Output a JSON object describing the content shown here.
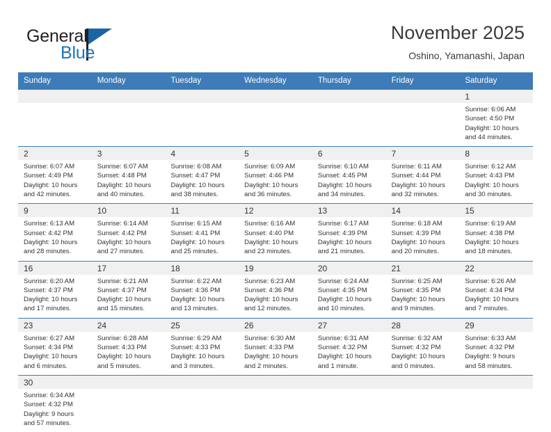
{
  "brand": {
    "name_top": "General",
    "name_bottom": "Blue",
    "accent_color": "#1b75bb",
    "flag_color": "#1b64a5"
  },
  "header": {
    "title": "November 2025",
    "subtitle": "Oshino, Yamanashi, Japan"
  },
  "theme": {
    "header_blue": "#3d7cb8",
    "day_band_gray": "#f0f0f0",
    "text_color": "#333333"
  },
  "weekdays": [
    "Sunday",
    "Monday",
    "Tuesday",
    "Wednesday",
    "Thursday",
    "Friday",
    "Saturday"
  ],
  "weeks": [
    [
      {
        "day": "",
        "lines": []
      },
      {
        "day": "",
        "lines": []
      },
      {
        "day": "",
        "lines": []
      },
      {
        "day": "",
        "lines": []
      },
      {
        "day": "",
        "lines": []
      },
      {
        "day": "",
        "lines": []
      },
      {
        "day": "1",
        "lines": [
          "Sunrise: 6:06 AM",
          "Sunset: 4:50 PM",
          "Daylight: 10 hours",
          "and 44 minutes."
        ]
      }
    ],
    [
      {
        "day": "2",
        "lines": [
          "Sunrise: 6:07 AM",
          "Sunset: 4:49 PM",
          "Daylight: 10 hours",
          "and 42 minutes."
        ]
      },
      {
        "day": "3",
        "lines": [
          "Sunrise: 6:07 AM",
          "Sunset: 4:48 PM",
          "Daylight: 10 hours",
          "and 40 minutes."
        ]
      },
      {
        "day": "4",
        "lines": [
          "Sunrise: 6:08 AM",
          "Sunset: 4:47 PM",
          "Daylight: 10 hours",
          "and 38 minutes."
        ]
      },
      {
        "day": "5",
        "lines": [
          "Sunrise: 6:09 AM",
          "Sunset: 4:46 PM",
          "Daylight: 10 hours",
          "and 36 minutes."
        ]
      },
      {
        "day": "6",
        "lines": [
          "Sunrise: 6:10 AM",
          "Sunset: 4:45 PM",
          "Daylight: 10 hours",
          "and 34 minutes."
        ]
      },
      {
        "day": "7",
        "lines": [
          "Sunrise: 6:11 AM",
          "Sunset: 4:44 PM",
          "Daylight: 10 hours",
          "and 32 minutes."
        ]
      },
      {
        "day": "8",
        "lines": [
          "Sunrise: 6:12 AM",
          "Sunset: 4:43 PM",
          "Daylight: 10 hours",
          "and 30 minutes."
        ]
      }
    ],
    [
      {
        "day": "9",
        "lines": [
          "Sunrise: 6:13 AM",
          "Sunset: 4:42 PM",
          "Daylight: 10 hours",
          "and 28 minutes."
        ]
      },
      {
        "day": "10",
        "lines": [
          "Sunrise: 6:14 AM",
          "Sunset: 4:42 PM",
          "Daylight: 10 hours",
          "and 27 minutes."
        ]
      },
      {
        "day": "11",
        "lines": [
          "Sunrise: 6:15 AM",
          "Sunset: 4:41 PM",
          "Daylight: 10 hours",
          "and 25 minutes."
        ]
      },
      {
        "day": "12",
        "lines": [
          "Sunrise: 6:16 AM",
          "Sunset: 4:40 PM",
          "Daylight: 10 hours",
          "and 23 minutes."
        ]
      },
      {
        "day": "13",
        "lines": [
          "Sunrise: 6:17 AM",
          "Sunset: 4:39 PM",
          "Daylight: 10 hours",
          "and 21 minutes."
        ]
      },
      {
        "day": "14",
        "lines": [
          "Sunrise: 6:18 AM",
          "Sunset: 4:39 PM",
          "Daylight: 10 hours",
          "and 20 minutes."
        ]
      },
      {
        "day": "15",
        "lines": [
          "Sunrise: 6:19 AM",
          "Sunset: 4:38 PM",
          "Daylight: 10 hours",
          "and 18 minutes."
        ]
      }
    ],
    [
      {
        "day": "16",
        "lines": [
          "Sunrise: 6:20 AM",
          "Sunset: 4:37 PM",
          "Daylight: 10 hours",
          "and 17 minutes."
        ]
      },
      {
        "day": "17",
        "lines": [
          "Sunrise: 6:21 AM",
          "Sunset: 4:37 PM",
          "Daylight: 10 hours",
          "and 15 minutes."
        ]
      },
      {
        "day": "18",
        "lines": [
          "Sunrise: 6:22 AM",
          "Sunset: 4:36 PM",
          "Daylight: 10 hours",
          "and 13 minutes."
        ]
      },
      {
        "day": "19",
        "lines": [
          "Sunrise: 6:23 AM",
          "Sunset: 4:36 PM",
          "Daylight: 10 hours",
          "and 12 minutes."
        ]
      },
      {
        "day": "20",
        "lines": [
          "Sunrise: 6:24 AM",
          "Sunset: 4:35 PM",
          "Daylight: 10 hours",
          "and 10 minutes."
        ]
      },
      {
        "day": "21",
        "lines": [
          "Sunrise: 6:25 AM",
          "Sunset: 4:35 PM",
          "Daylight: 10 hours",
          "and 9 minutes."
        ]
      },
      {
        "day": "22",
        "lines": [
          "Sunrise: 6:26 AM",
          "Sunset: 4:34 PM",
          "Daylight: 10 hours",
          "and 7 minutes."
        ]
      }
    ],
    [
      {
        "day": "23",
        "lines": [
          "Sunrise: 6:27 AM",
          "Sunset: 4:34 PM",
          "Daylight: 10 hours",
          "and 6 minutes."
        ]
      },
      {
        "day": "24",
        "lines": [
          "Sunrise: 6:28 AM",
          "Sunset: 4:33 PM",
          "Daylight: 10 hours",
          "and 5 minutes."
        ]
      },
      {
        "day": "25",
        "lines": [
          "Sunrise: 6:29 AM",
          "Sunset: 4:33 PM",
          "Daylight: 10 hours",
          "and 3 minutes."
        ]
      },
      {
        "day": "26",
        "lines": [
          "Sunrise: 6:30 AM",
          "Sunset: 4:33 PM",
          "Daylight: 10 hours",
          "and 2 minutes."
        ]
      },
      {
        "day": "27",
        "lines": [
          "Sunrise: 6:31 AM",
          "Sunset: 4:32 PM",
          "Daylight: 10 hours",
          "and 1 minute."
        ]
      },
      {
        "day": "28",
        "lines": [
          "Sunrise: 6:32 AM",
          "Sunset: 4:32 PM",
          "Daylight: 10 hours",
          "and 0 minutes."
        ]
      },
      {
        "day": "29",
        "lines": [
          "Sunrise: 6:33 AM",
          "Sunset: 4:32 PM",
          "Daylight: 9 hours",
          "and 58 minutes."
        ]
      }
    ],
    [
      {
        "day": "30",
        "lines": [
          "Sunrise: 6:34 AM",
          "Sunset: 4:32 PM",
          "Daylight: 9 hours",
          "and 57 minutes."
        ]
      },
      {
        "day": "",
        "lines": []
      },
      {
        "day": "",
        "lines": []
      },
      {
        "day": "",
        "lines": []
      },
      {
        "day": "",
        "lines": []
      },
      {
        "day": "",
        "lines": []
      },
      {
        "day": "",
        "lines": []
      }
    ]
  ]
}
